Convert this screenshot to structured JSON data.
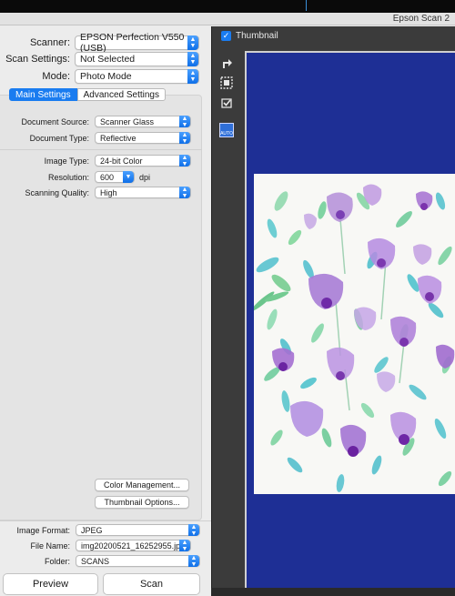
{
  "window": {
    "title": "Epson Scan 2"
  },
  "scanner": {
    "label": "Scanner:",
    "value": "EPSON Perfection V550 (USB)"
  },
  "scan_settings": {
    "label": "Scan Settings:",
    "value": "Not Selected"
  },
  "mode": {
    "label": "Mode:",
    "value": "Photo Mode"
  },
  "tabs": {
    "main": "Main Settings",
    "advanced": "Advanced Settings"
  },
  "main": {
    "document_source": {
      "label": "Document Source:",
      "value": "Scanner Glass"
    },
    "document_type": {
      "label": "Document Type:",
      "value": "Reflective"
    },
    "image_type": {
      "label": "Image Type:",
      "value": "24-bit Color"
    },
    "resolution": {
      "label": "Resolution:",
      "value": "600",
      "unit": "dpi"
    },
    "scanning_quality": {
      "label": "Scanning Quality:",
      "value": "High"
    },
    "color_management_button": "Color Management...",
    "thumbnail_options_button": "Thumbnail Options..."
  },
  "output": {
    "image_format": {
      "label": "Image Format:",
      "value": "JPEG"
    },
    "file_name": {
      "label": "File Name:",
      "value": "img20200521_16252955.jpg"
    },
    "folder": {
      "label": "Folder:",
      "value": "SCANS"
    }
  },
  "actions": {
    "preview": "Preview",
    "scan": "Scan"
  },
  "thumbnail": {
    "label": "Thumbnail",
    "checked": true,
    "auto_label": "AUTO"
  },
  "icons": {
    "rotate": "rotate-icon",
    "select_all": "select-all-icon",
    "thumbnail_check": "check-icon"
  },
  "colors": {
    "accent": "#1a7cf0",
    "preview_bg": "#1e2f95",
    "panel_dark": "#3b3b3b"
  }
}
